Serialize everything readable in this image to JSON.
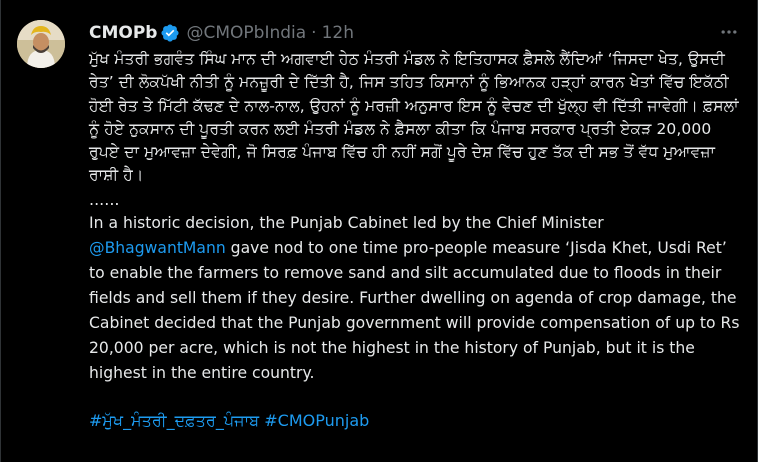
{
  "author": {
    "name": "CMOPb",
    "handle": "@CMOPbIndia",
    "separator": "·",
    "time": "12h"
  },
  "colors": {
    "background": "#000000",
    "text": "#e7e9ea",
    "muted": "#71767b",
    "link": "#1d9bf0",
    "verified_badge": "#1d9bf0"
  },
  "tweet": {
    "punjabi_text": "ਮੁੱਖ ਮੰਤਰੀ ਭਗਵੰਤ ਸਿੰਘ ਮਾਨ ਦੀ ਅਗਵਾਈ ਹੇਠ ਮੰਤਰੀ ਮੰਡਲ ਨੇ ਇਤਿਹਾਸਕ ਫ਼ੈਸਲੇ ਲੈਂਦਿਆਂ ‘ਜਿਸਦਾ ਖੇਤ, ਉਸਦੀ ਰੇਤ’ ਦੀ ਲੋਕਪੱਖੀ ਨੀਤੀ ਨੂੰ ਮਨਜ਼ੂਰੀ ਦੇ ਦਿੱਤੀ ਹੈ, ਜਿਸ ਤਹਿਤ ਕਿਸਾਨਾਂ ਨੂੰ ਭਿਆਨਕ ਹੜ੍ਹਾਂ ਕਾਰਨ ਖੇਤਾਂ ਵਿੱਚ ਇਕੱਠੀ ਹੋਈ ਰੇਤ ਤੇ ਮਿੱਟੀ ਕੱਢਣ ਦੇ ਨਾਲ-ਨਾਲ, ਉਹਨਾਂ ਨੂੰ ਮਰਜ਼ੀ ਅਨੁਸਾਰ ਇਸ ਨੂੰ ਵੇਚਣ ਦੀ ਖੁੱਲ੍ਹ ਵੀ ਦਿੱਤੀ ਜਾਵੇਗੀ। ਫ਼ਸਲਾਂ ਨੂੰ ਹੋਏ ਨੁਕਸਾਨ ਦੀ ਪੂਰਤੀ ਕਰਨ ਲਈ ਮੰਤਰੀ ਮੰਡਲ ਨੇ ਫ਼ੈਸਲਾ ਕੀਤਾ ਕਿ ਪੰਜਾਬ ਸਰਕਾਰ ਪ੍ਰਤੀ ਏਕੜ 20,000 ਰੁਪਏ ਦਾ ਮੁਆਵਜ਼ਾ ਦੇਵੇਗੀ, ਜੋ ਸਿਰਫ਼ ਪੰਜਾਬ ਵਿੱਚ ਹੀ ਨਹੀਂ ਸਗੋਂ ਪੂਰੇ ਦੇਸ਼ ਵਿੱਚ ਹੁਣ ਤੱਕ ਦੀ ਸਭ ਤੋਂ ਵੱਧ ਮੁਆਵਜ਼ਾ ਰਾਸ਼ੀ ਹੈ।",
    "separator": "......",
    "english_before_mention": "In a historic decision, the Punjab Cabinet led by the Chief Minister",
    "mention": "@BhagwantMann",
    "english_after_mention": " gave nod to one time pro-people measure ‘Jisda Khet, Usdi Ret’ to enable the farmers to remove sand and silt accumulated due to floods in their fields and sell them if they desire. Further dwelling on agenda of crop damage, the Cabinet decided that the Punjab government will provide compensation of up to Rs 20,000 per acre, which is not the highest in the history of Punjab, but it is the highest in the entire country.",
    "hashtags": [
      "#ਮੁੱਖ_ਮੰਤਰੀ_ਦਫ਼ਤਰ_ਪੰਜਾਬ",
      "#CMOPunjab"
    ]
  },
  "icons": {
    "avatar": "avatar-portrait",
    "verified": "verified-badge-icon",
    "more": "more-options-icon"
  }
}
